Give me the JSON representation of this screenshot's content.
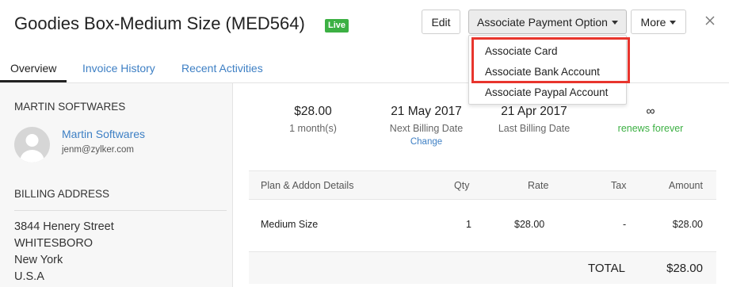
{
  "header": {
    "title": "Goodies Box-Medium Size (MED564)",
    "badge": "Live",
    "edit_label": "Edit",
    "associate_label": "Associate Payment Option",
    "more_label": "More"
  },
  "dropdown": {
    "items": [
      "Associate Card",
      "Associate Bank Account",
      "Associate Paypal Account"
    ]
  },
  "tabs": [
    "Overview",
    "Invoice History",
    "Recent Activities"
  ],
  "sidebar": {
    "customer_heading": "MARTIN SOFTWARES",
    "customer_name": "Martin Softwares",
    "customer_email": "jenm@zylker.com",
    "billing_heading": "BILLING ADDRESS",
    "address": [
      "3844 Henery Street",
      "WHITESBORO",
      "New York",
      "U.S.A"
    ]
  },
  "stats": {
    "amount": {
      "value": "$28.00",
      "label": "1 month(s)"
    },
    "next_billing": {
      "value": "21 May 2017",
      "label": "Next Billing Date",
      "link": "Change"
    },
    "last_billing": {
      "value": "21 Apr 2017",
      "label": "Last Billing Date"
    },
    "renews": {
      "value": "∞",
      "label": "renews forever"
    }
  },
  "table": {
    "headers": [
      "Plan & Addon Details",
      "Qty",
      "Rate",
      "Tax",
      "Amount"
    ],
    "rows": [
      {
        "details": "Medium Size",
        "qty": "1",
        "rate": "$28.00",
        "tax": "-",
        "amount": "$28.00"
      }
    ],
    "total_label": "TOTAL",
    "total_value": "$28.00"
  },
  "colors": {
    "accent": "#3d7fc4",
    "live": "#3cb043",
    "highlight": "#e8352d"
  }
}
